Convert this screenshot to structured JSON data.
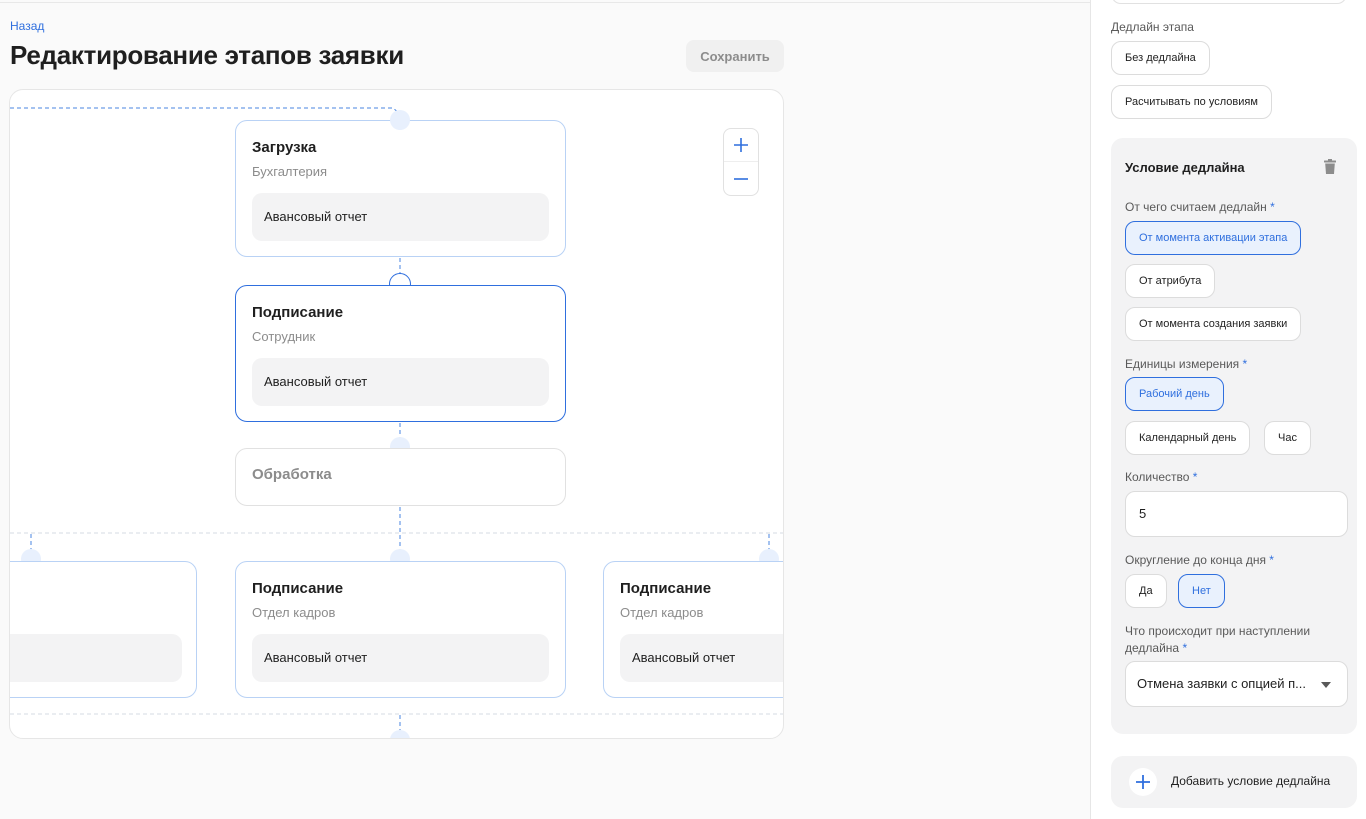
{
  "header": {
    "back_label": "Назад",
    "title": "Редактирование этапов заявки",
    "save_label": "Сохранить"
  },
  "zoom": {
    "plus": "+",
    "minus": "—"
  },
  "stages": [
    {
      "title": "Загрузка",
      "subtitle": "Бухгалтерия",
      "document": "Авансовый отчет"
    },
    {
      "title": "Подписание",
      "subtitle": "Сотрудник",
      "document": "Авансовый отчет"
    },
    {
      "title": "Обработка"
    },
    {
      "title": "Подписание",
      "subtitle": "Отдел кадров",
      "document": "Авансовый отчет"
    },
    {
      "title": "Подписание",
      "subtitle": "Отдел кадров",
      "document": "Авансовый отчет"
    }
  ],
  "panel": {
    "stage_deadline_label": "Дедлайн этапа",
    "no_deadline": "Без дедлайна",
    "by_conditions": "Расчитывать по условиям",
    "condition": {
      "title": "Условие дедлайна",
      "from_label": "От чего считаем дедлайн",
      "from_options": [
        "От момента активации этапа",
        "От атрибута",
        "От момента создания заявки"
      ],
      "from_selected": "От момента активации этапа",
      "units_label": "Единицы измерения",
      "units_options": [
        "Рабочий день",
        "Календарный день",
        "Час"
      ],
      "units_selected": "Рабочий день",
      "quantity_label": "Количество",
      "quantity_value": "5",
      "rounding_label": "Округление до конца дня",
      "rounding_options": [
        "Да",
        "Нет"
      ],
      "rounding_selected": "Нет",
      "on_deadline_label_1": "Что происходит при наступлении",
      "on_deadline_label_2": "дедлайна",
      "on_deadline_value": "Отмена заявки с опцией п..."
    },
    "add_condition": "Добавить условие дедлайна"
  },
  "required_mark": "*",
  "colors": {
    "accent": "#2f6fde",
    "accent_bg": "#e9f1fd",
    "node_border": "#b9d2f5"
  },
  "icons": {
    "trash": "trash-icon",
    "plus": "plus-icon",
    "caret": "chevron-down-icon"
  }
}
